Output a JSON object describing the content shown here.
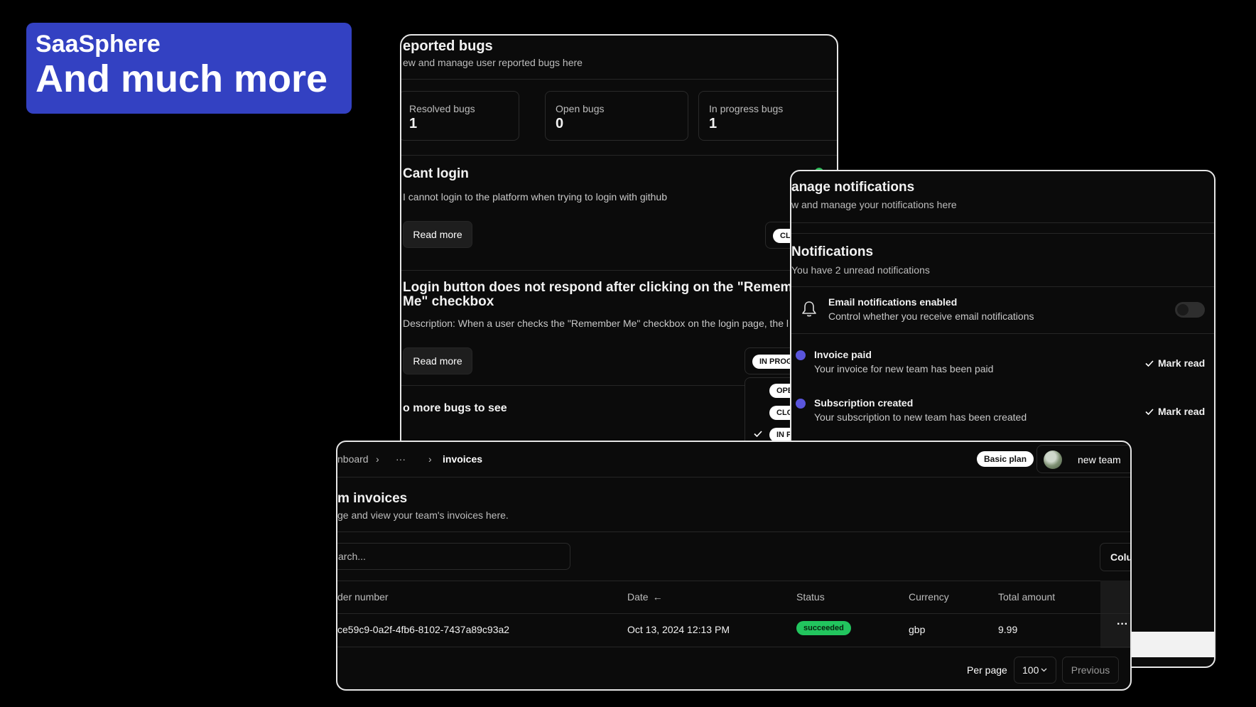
{
  "banner": {
    "brand": "SaaSphere",
    "tagline": "And much more"
  },
  "bugs": {
    "title": "eported bugs",
    "subtitle": "ew and manage user reported bugs here",
    "stats": [
      {
        "label": "Resolved bugs",
        "value": "1"
      },
      {
        "label": "Open bugs",
        "value": "0"
      },
      {
        "label": "In progress bugs",
        "value": "1"
      }
    ],
    "items": [
      {
        "title": "Cant login",
        "description": "I cannot login to the platform when trying to login with github",
        "button": "Read more",
        "status": "CL"
      },
      {
        "title_line1": "Login button does not respond after clicking on the \"Remember",
        "title_line2": "Me\" checkbox",
        "description": "Description: When a user checks the \"Remember Me\" checkbox on the login page, the l",
        "button": "Read more",
        "status": "IN PROG"
      }
    ],
    "status_options": [
      "OPE",
      "CLO",
      "IN P"
    ],
    "empty_text": "o more bugs to see"
  },
  "notifications": {
    "title": "anage notifications",
    "subtitle": "w and manage your notifications here",
    "section_title": "Notifications",
    "section_subtitle": "You have 2 unread notifications",
    "email": {
      "title": "Email notifications enabled",
      "subtitle": "Control whether you receive email notifications",
      "enabled": false
    },
    "items": [
      {
        "title": "Invoice paid",
        "subtitle": "Your invoice for new team has been paid",
        "action": "Mark read"
      },
      {
        "title": "Subscription created",
        "subtitle": "Your subscription to new team has been created",
        "action": "Mark read"
      }
    ],
    "accent_color": "#5a55dc"
  },
  "invoices": {
    "breadcrumb": {
      "first": "nboard",
      "ellipsis": "···",
      "current": "invoices"
    },
    "plan_badge": "Basic plan",
    "team_name": "new team",
    "title": "m invoices",
    "subtitle": "ge and view your team's invoices here.",
    "search_placeholder": "arch...",
    "columns_button": "Colu",
    "headers": {
      "order": "der number",
      "date": "Date",
      "status": "Status",
      "currency": "Currency",
      "total": "Total amount"
    },
    "rows": [
      {
        "order": "ce59c9-0a2f-4fb6-8102-7437a89c93a2",
        "date": "Oct 13, 2024 12:13 PM",
        "status": "succeeded",
        "currency": "gbp",
        "total": "9.99",
        "actions": "···"
      }
    ],
    "per_page_label": "Per page",
    "per_page_value": "100",
    "previous_button": "Previous",
    "success_color": "#22c55e"
  }
}
